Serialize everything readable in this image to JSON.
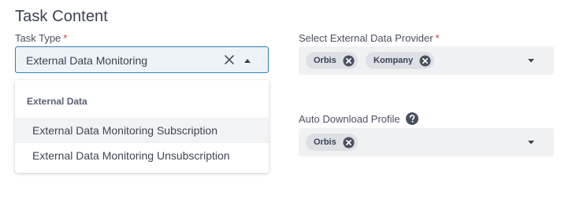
{
  "section": {
    "title": "Task Content"
  },
  "task_type": {
    "label": "Task Type",
    "required_marker": "*",
    "value": "External Data Monitoring",
    "dropdown": {
      "group_header": "External Data",
      "options": [
        {
          "label": "External Data Monitoring Subscription",
          "highlighted": true
        },
        {
          "label": "External Data Monitoring Unsubscription",
          "highlighted": false
        }
      ]
    }
  },
  "data_provider": {
    "label": "Select External Data Provider",
    "required_marker": "*",
    "chips": [
      {
        "label": "Orbis"
      },
      {
        "label": "Kompany"
      }
    ]
  },
  "auto_download": {
    "label": "Auto Download Profile",
    "help_icon": "question-circle-icon",
    "chips": [
      {
        "label": "Orbis"
      }
    ]
  },
  "colors": {
    "focus_border": "#2f80b8",
    "required": "#d33a3a",
    "chip_bg": "#dde0e5",
    "chip_remove": "#4a5060",
    "help_icon": "#4a5060"
  }
}
